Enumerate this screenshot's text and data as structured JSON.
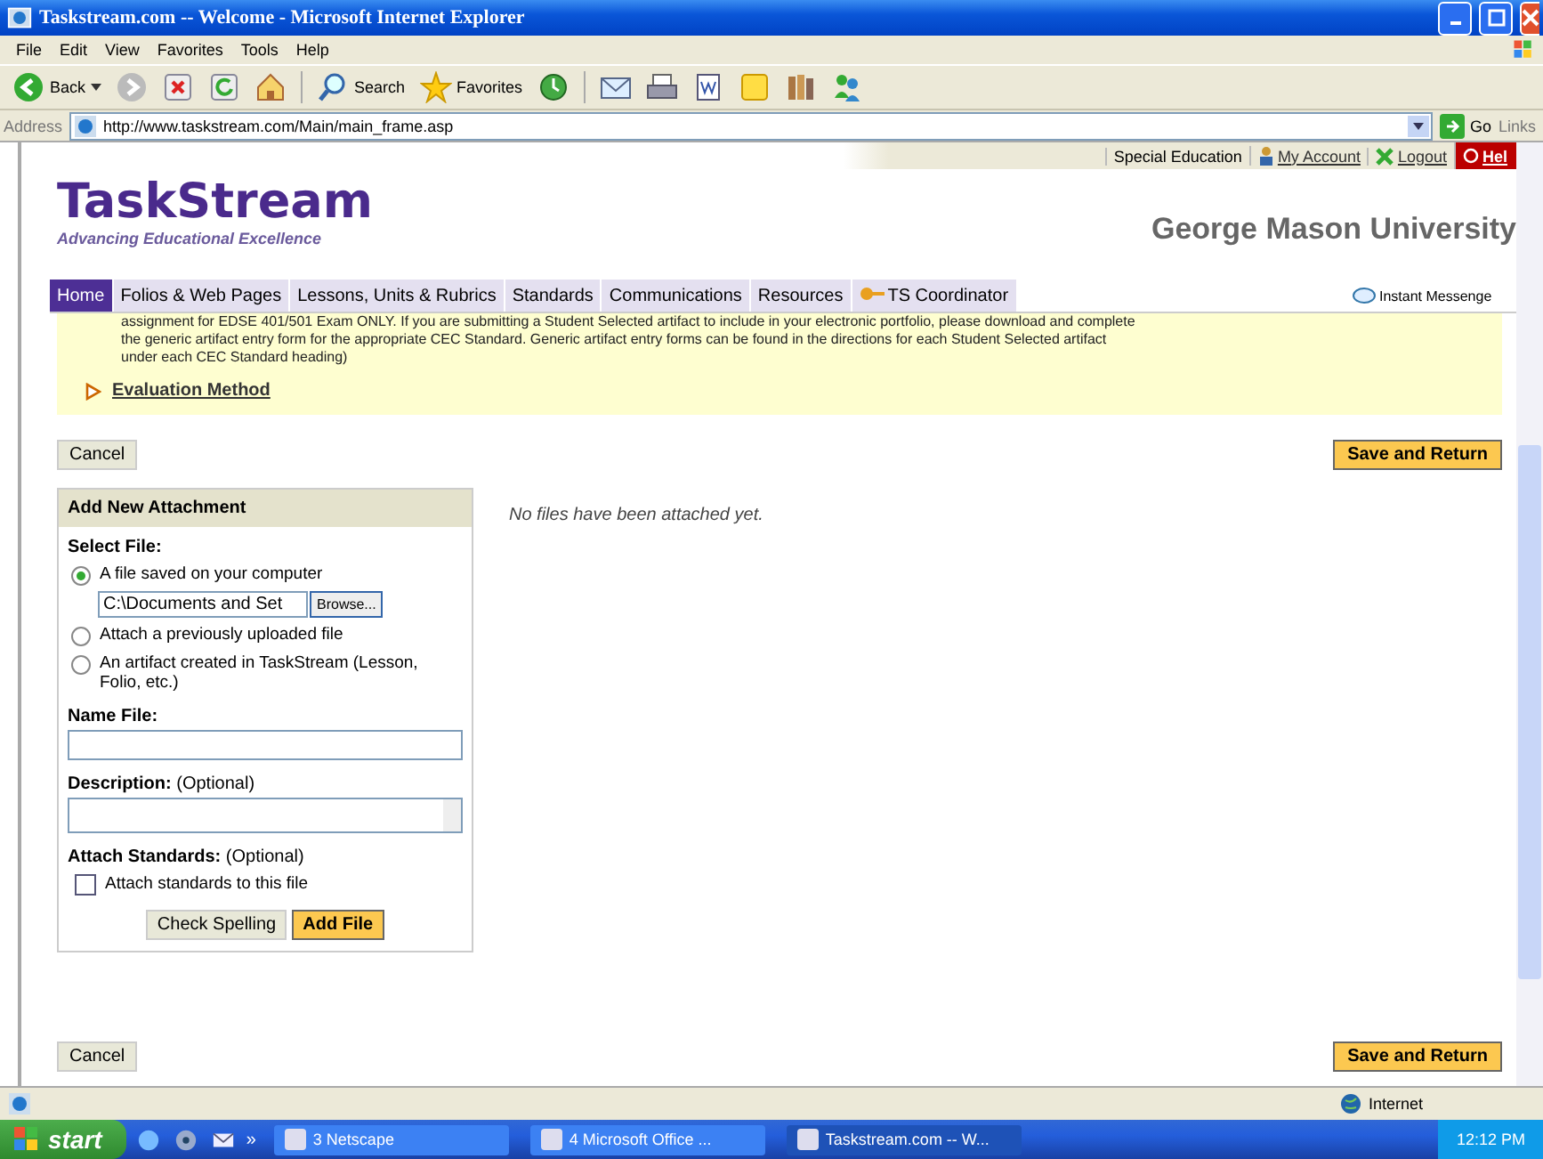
{
  "window": {
    "title": "Taskstream.com -- Welcome - Microsoft Internet Explorer"
  },
  "menu": [
    "File",
    "Edit",
    "View",
    "Favorites",
    "Tools",
    "Help"
  ],
  "toolbar": {
    "back": "Back",
    "search": "Search",
    "favorites": "Favorites"
  },
  "address": {
    "label": "Address",
    "url": "http://www.taskstream.com/Main/main_frame.asp",
    "go": "Go",
    "links": "Links"
  },
  "top_links": [
    {
      "kind": "text",
      "label": "Special Education"
    },
    {
      "kind": "account",
      "label": "My Account"
    },
    {
      "kind": "logout",
      "label": "Logout"
    },
    {
      "kind": "help",
      "label": "Hel"
    }
  ],
  "logo": {
    "name": "TaskStream",
    "tagline": "Advancing Educational Excellence"
  },
  "institution": "George Mason University",
  "tabs": [
    {
      "label": "Home",
      "selected": true
    },
    {
      "label": "Folios & Web Pages",
      "selected": false
    },
    {
      "label": "Lessons, Units & Rubrics",
      "selected": false
    },
    {
      "label": "Standards",
      "selected": false
    },
    {
      "label": "Communications",
      "selected": false
    },
    {
      "label": "Resources",
      "selected": false
    },
    {
      "label": "TS Coordinator",
      "selected": false,
      "kind": "coordinator"
    }
  ],
  "instant_messenger": "Instant Messenge",
  "notice_lines": [
    "assignment for EDSE 401/501 Exam ONLY. If you are submitting a Student Selected artifact to include in your electronic portfolio, please download and complete",
    "the generic artifact entry form for the appropriate CEC Standard. Generic artifact entry forms can be found in the directions for each Student Selected artifact",
    "under each CEC Standard heading)"
  ],
  "evaluation_link": "Evaluation Method",
  "top_buttons": {
    "cancel": "Cancel",
    "save": "Save and Return"
  },
  "bottom_buttons": {
    "cancel": "Cancel",
    "save": "Save and Return"
  },
  "panel": {
    "title": "Add New Attachment",
    "select_label": "Select File:",
    "options": [
      {
        "label": "A file saved on your computer",
        "selected": true
      },
      {
        "label": "Attach a previously uploaded file",
        "selected": false
      },
      {
        "label": "An artifact created in TaskStream (Lesson, Folio, etc.)",
        "selected": false
      }
    ],
    "file_value": "C:\\Documents and Set",
    "browse": "Browse...",
    "name_label": "Name File:",
    "desc_label": "Description:",
    "desc_note": "(Optional)",
    "standards_label": "Attach Standards:",
    "standards_note": "(Optional)",
    "standards_checkbox": {
      "label": "Attach standards to this file",
      "checked": false
    },
    "spell": "Check Spelling",
    "add": "Add File"
  },
  "empty_message": "No files have been attached yet.",
  "status": {
    "zone": "Internet"
  },
  "taskbar": {
    "start": "start",
    "more": "»",
    "items": [
      {
        "label": "3 Netscape",
        "selected": false
      },
      {
        "label": "4 Microsoft Office ...",
        "selected": false
      },
      {
        "label": "Taskstream.com -- W...",
        "selected": true
      }
    ],
    "clock": "12:12 PM"
  }
}
